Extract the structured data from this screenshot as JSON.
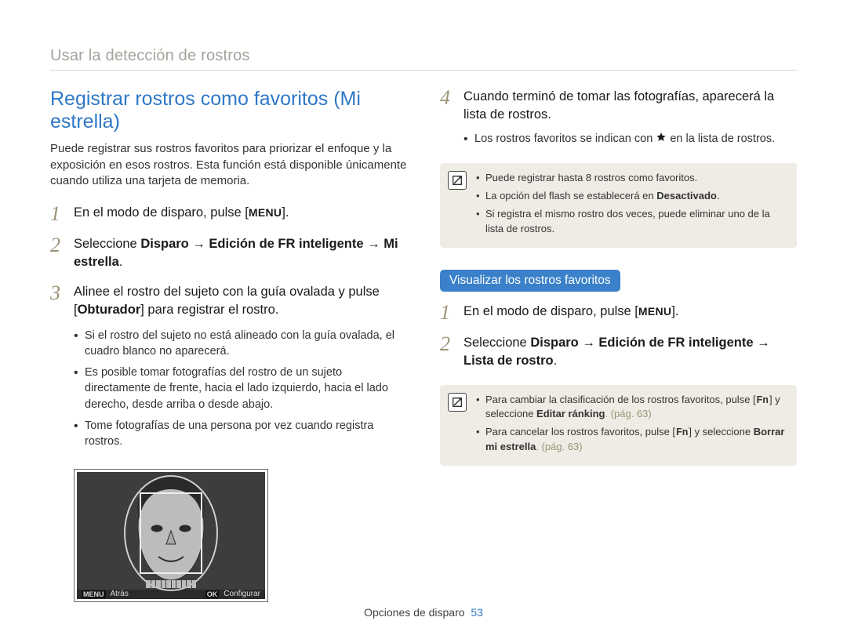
{
  "breadcrumb": "Usar la detección de rostros",
  "left": {
    "heading": "Registrar rostros como favoritos (Mi estrella)",
    "intro": "Puede registrar sus rostros favoritos para priorizar el enfoque y la exposición en esos rostros. Esta función está disponible únicamente cuando utiliza una tarjeta de memoria.",
    "steps": {
      "s1": {
        "num": "1",
        "pre": "En el modo de disparo, pulse [",
        "menu": "MENU",
        "post": "]."
      },
      "s2": {
        "num": "2",
        "a": "Seleccione ",
        "b": "Disparo",
        "arrow1": " → ",
        "c": "Edición de FR inteligente",
        "arrow2": " → ",
        "d": "Mi estrella",
        "tail": "."
      },
      "s3": {
        "num": "3",
        "line_a": "Alinee el rostro del sujeto con la guía ovalada y pulse",
        "line_b_pre": "[",
        "line_b_bold": "Obturador",
        "line_b_post": "] para registrar el rostro.",
        "bullets": [
          "Si el rostro del sujeto no está alineado con la guía ovalada, el cuadro blanco no aparecerá.",
          "Es posible tomar fotografías del rostro de un sujeto directamente de frente, hacia el lado izquierdo, hacia el lado derecho, desde arriba o desde abajo.",
          "Tome fotografías de una persona por vez cuando registra rostros."
        ]
      }
    },
    "cam": {
      "menu": "MENU",
      "back": "Atrás",
      "ok": "OK",
      "set": "Configurar"
    }
  },
  "right": {
    "s4": {
      "num": "4",
      "text": "Cuando terminó de tomar las fotografías, aparecerá la lista de rostros.",
      "bullet_pre": "Los rostros favoritos se indican con ",
      "bullet_post": " en la lista de rostros."
    },
    "note1": {
      "b1": "Puede registrar hasta 8 rostros como favoritos.",
      "b2_pre": "La opción del flash se establecerá en ",
      "b2_bold": "Desactivado",
      "b2_post": ".",
      "b3": "Si registra el mismo rostro dos veces, puede eliminar uno de la lista de rostros."
    },
    "pill": "Visualizar los rostros favoritos",
    "v1": {
      "num": "1",
      "pre": "En el modo de disparo, pulse [",
      "menu": "MENU",
      "post": "]."
    },
    "v2": {
      "num": "2",
      "a": "Seleccione ",
      "b": "Disparo",
      "arrow1": " → ",
      "c": "Edición de FR inteligente",
      "arrow2": " → ",
      "d": "Lista de rostro",
      "tail": "."
    },
    "note2": {
      "b1_pre": "Para cambiar la clasificación de los rostros favoritos, pulse [",
      "b1_fn": "Fn",
      "b1_mid": "] y seleccione ",
      "b1_bold": "Editar ránking",
      "b1_post": ". (pág. 63)",
      "b2_pre": "Para cancelar los rostros favoritos, pulse [",
      "b2_fn": "Fn",
      "b2_mid": "] y seleccione ",
      "b2_bold": "Borrar mi estrella",
      "b2_post": ". (pág. 63)"
    }
  },
  "footer": {
    "section": "Opciones de disparo",
    "page": "53"
  }
}
